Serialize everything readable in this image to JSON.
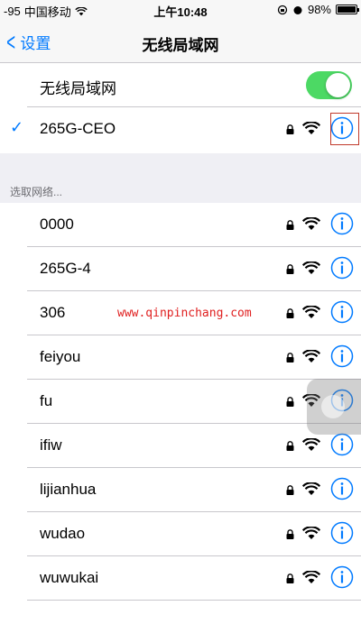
{
  "status_bar": {
    "signal": "-95",
    "carrier": "中国移动",
    "time": "上午10:48",
    "battery": "98%",
    "battery_level": 0.98
  },
  "nav": {
    "back_label": "设置",
    "title": "无线局域网"
  },
  "wifi_toggle": {
    "label": "无线局域网",
    "on": true,
    "on_color": "#4cd964"
  },
  "connected_network": {
    "name": "265G-CEO",
    "secured": true
  },
  "section_header": "选取网络...",
  "networks": [
    {
      "name": "0000",
      "secured": true
    },
    {
      "name": "265G-4",
      "secured": true
    },
    {
      "name": "306",
      "secured": true
    },
    {
      "name": "feiyou",
      "secured": true
    },
    {
      "name": "fu",
      "secured": true
    },
    {
      "name": "ifiw",
      "secured": true
    },
    {
      "name": "lijianhua",
      "secured": true
    },
    {
      "name": "wudao",
      "secured": true
    },
    {
      "name": "wuwukai",
      "secured": true
    }
  ],
  "watermark": "www.qinpinchang.com",
  "colors": {
    "accent": "#007aff",
    "highlight": "#c0392b"
  }
}
